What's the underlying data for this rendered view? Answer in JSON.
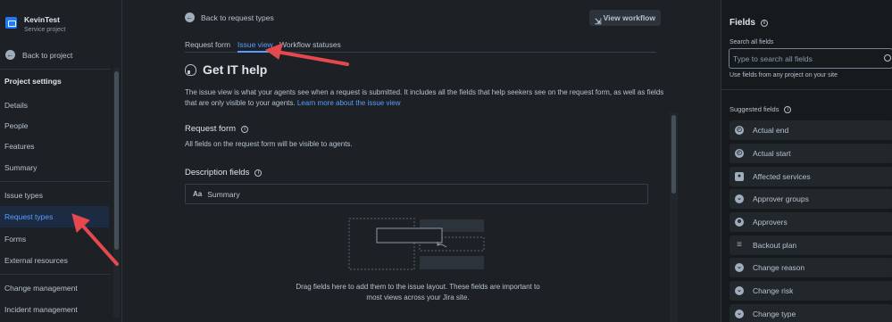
{
  "sidebar": {
    "project_name": "KevinTest",
    "project_type": "Service project",
    "back_label": "Back to project",
    "section_title": "Project settings",
    "items": [
      {
        "label": "Details"
      },
      {
        "label": "People"
      },
      {
        "label": "Features"
      },
      {
        "label": "Summary"
      },
      {
        "label": "Issue types"
      },
      {
        "label": "Request types"
      },
      {
        "label": "Forms"
      },
      {
        "label": "External resources"
      },
      {
        "label": "Change management"
      },
      {
        "label": "Incident management"
      }
    ],
    "active_item": "Request types"
  },
  "main": {
    "back_label": "Back to request types",
    "view_workflow_label": "View workflow",
    "tabs": [
      {
        "label": "Request form"
      },
      {
        "label": "Issue view"
      },
      {
        "label": "Workflow statuses"
      }
    ],
    "active_tab": "Issue view",
    "title": "Get IT help",
    "description": "The issue view is what your agents see when a request is submitted. It includes all the fields that help seekers see on the request form, as well as fields that are only visible to your agents.",
    "learn_more_label": "Learn more about the issue view",
    "request_form_section": {
      "title": "Request form",
      "text": "All fields on the request form will be visible to agents."
    },
    "description_fields_section": {
      "title": "Description fields",
      "field_icon": "Aa",
      "field_label": "Summary"
    },
    "drop_hint_line1": "Drag fields here to add them to the issue layout. These fields are important to",
    "drop_hint_line2": "most views across your Jira site."
  },
  "right_panel": {
    "title": "Fields",
    "search_label": "Search all fields",
    "search_placeholder": "Type to search all fields",
    "search_hint": "Use fields from any project on your site",
    "suggested_title": "Suggested fields",
    "suggested_fields": [
      {
        "label": "Actual end",
        "icon": "clock-icon"
      },
      {
        "label": "Actual start",
        "icon": "clock-icon"
      },
      {
        "label": "Affected services",
        "icon": "tag-icon"
      },
      {
        "label": "Approver groups",
        "icon": "chevron-circle-icon"
      },
      {
        "label": "Approvers",
        "icon": "person-icon"
      },
      {
        "label": "Backout plan",
        "icon": "text-lines-icon"
      },
      {
        "label": "Change reason",
        "icon": "chevron-circle-icon"
      },
      {
        "label": "Change risk",
        "icon": "chevron-circle-icon"
      },
      {
        "label": "Change type",
        "icon": "chevron-circle-icon"
      }
    ]
  },
  "colors": {
    "background": "#1d2125",
    "panel": "#161a1d",
    "accent": "#579dff",
    "annotation_arrow": "#e5484d"
  }
}
